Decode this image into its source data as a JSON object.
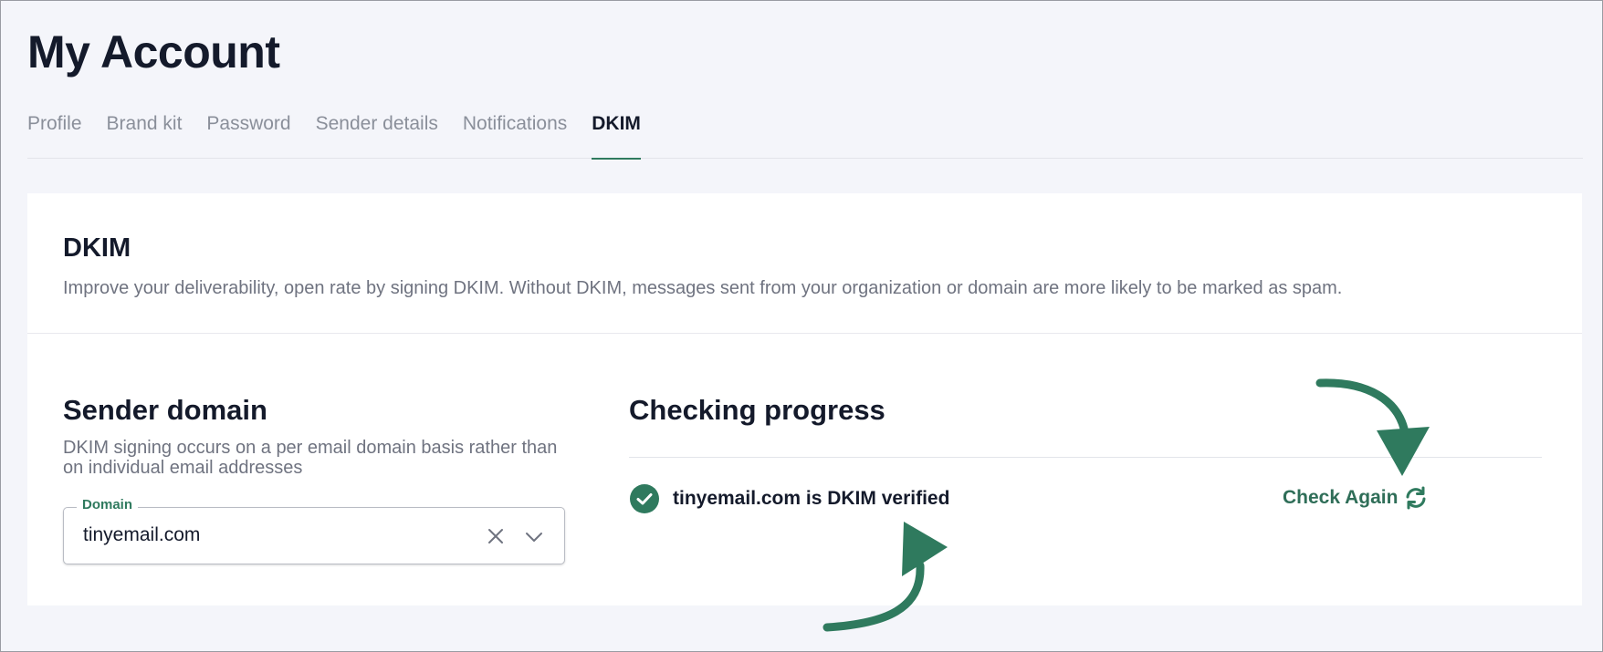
{
  "page": {
    "title": "My Account"
  },
  "tabs": [
    {
      "label": "Profile",
      "active": false
    },
    {
      "label": "Brand kit",
      "active": false
    },
    {
      "label": "Password",
      "active": false
    },
    {
      "label": "Sender details",
      "active": false
    },
    {
      "label": "Notifications",
      "active": false
    },
    {
      "label": "DKIM",
      "active": true
    }
  ],
  "card": {
    "title": "DKIM",
    "description": "Improve your deliverability, open rate by signing DKIM. Without DKIM, messages sent from your organization or domain are more likely to be marked as spam."
  },
  "sender_domain": {
    "title": "Sender domain",
    "description": "DKIM signing occurs on a per email domain basis rather than on individual email addresses",
    "field_label": "Domain",
    "field_value": "tinyemail.com"
  },
  "progress": {
    "title": "Checking progress",
    "status_text": "tinyemail.com is DKIM verified",
    "check_again_label": "Check Again"
  },
  "colors": {
    "accent": "#2f7a5e",
    "text": "#141a2b",
    "muted": "#6f7380",
    "background": "#f4f5fa"
  },
  "icons": {
    "status": "check-circle-icon",
    "refresh": "refresh-icon",
    "clear": "close-icon",
    "dropdown": "chevron-down-icon"
  }
}
